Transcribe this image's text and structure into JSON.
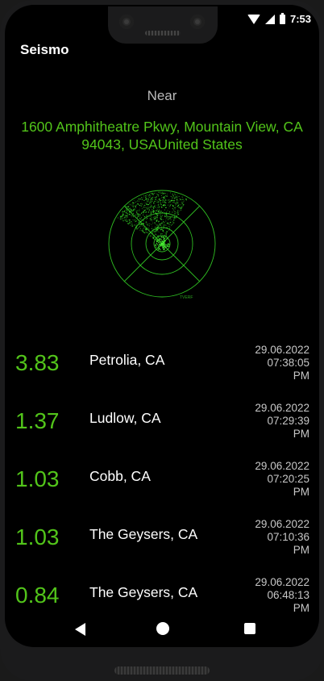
{
  "status_bar": {
    "time": "7:53",
    "icons": [
      "wifi-icon",
      "signal-icon",
      "battery-icon"
    ]
  },
  "app": {
    "title": "Seismo"
  },
  "location": {
    "heading": "Near",
    "address": "1600 Amphitheatre Pkwy, Mountain View, CA 94043, USAUnited States"
  },
  "radar": {
    "label": "TVERF"
  },
  "colors": {
    "accent": "#52c41a",
    "background": "#000000",
    "timestamp": "#c7c7c7"
  },
  "quakes": [
    {
      "magnitude": "3.83",
      "place": "Petrolia, CA",
      "date": "29.06.2022",
      "time": "07:38:05",
      "ampm": "PM"
    },
    {
      "magnitude": "1.37",
      "place": "Ludlow, CA",
      "date": "29.06.2022",
      "time": "07:29:39",
      "ampm": "PM"
    },
    {
      "magnitude": "1.03",
      "place": "Cobb, CA",
      "date": "29.06.2022",
      "time": "07:20:25",
      "ampm": "PM"
    },
    {
      "magnitude": "1.03",
      "place": "The Geysers, CA",
      "date": "29.06.2022",
      "time": "07:10:36",
      "ampm": "PM"
    },
    {
      "magnitude": "0.84",
      "place": "The Geysers, CA",
      "date": "29.06.2022",
      "time": "06:48:13",
      "ampm": "PM"
    }
  ],
  "nav": {
    "buttons": [
      "back-button",
      "home-button",
      "recents-button"
    ]
  }
}
